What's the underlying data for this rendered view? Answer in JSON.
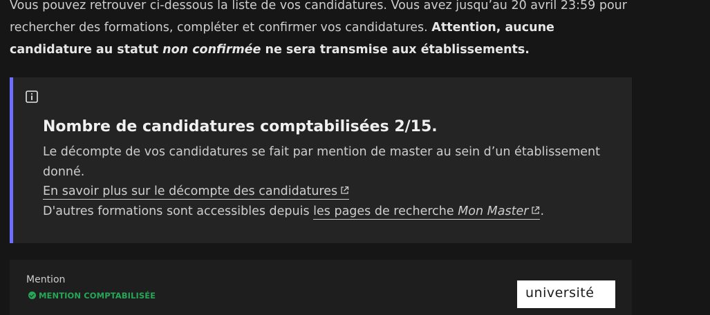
{
  "intro": {
    "text_1": "Vous pouvez retrouver ci-dessous la liste de vos candidatures. Vous avez jusqu’au 20 avril 23:59 pour rechercher des formations, compléter et confirmer vos candidatures. ",
    "strong_1": "Attention, aucune candidature au statut ",
    "strong_em": "non confirmée",
    "strong_2": " ne sera transmise aux établissements."
  },
  "notice": {
    "icon": "info-icon",
    "title": "Nombre de candidatures comptabilisées 2/15.",
    "description": "Le décompte de vos candidatures se fait par mention de master au sein d’un établissement donné.",
    "link_count": "En savoir plus sur le décompte des candidatures",
    "other_prefix": "D'autres formations sont accessibles depuis ",
    "link_search": "les pages de recherche ",
    "link_search_em": "Mon Master",
    "other_suffix": "."
  },
  "card": {
    "mention_label": "Mention",
    "badge": "MENTION COMPTABILISÉE",
    "logo_text": "université"
  },
  "colors": {
    "accent": "#6d6dff",
    "success": "#27a658",
    "background": "#161616",
    "panel": "#242424"
  }
}
